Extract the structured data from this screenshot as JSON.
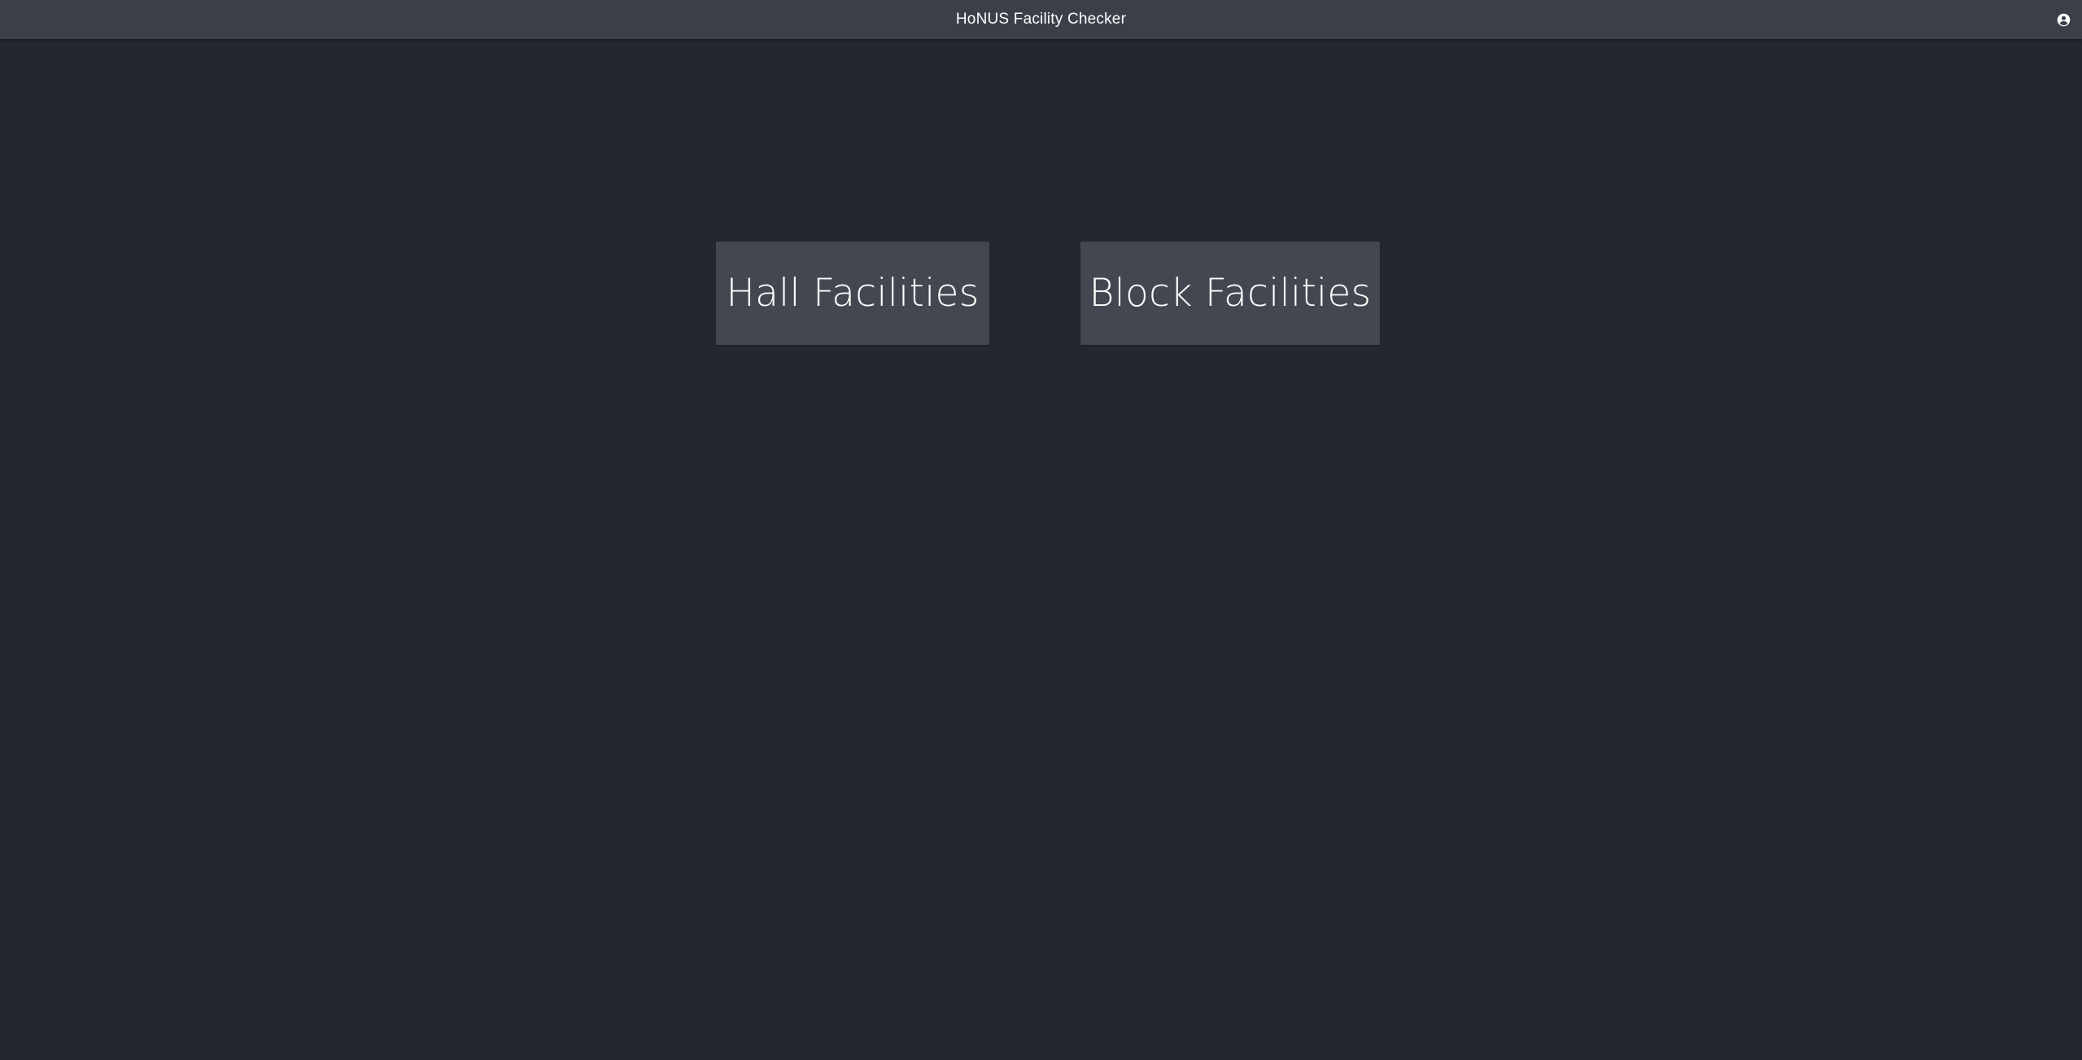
{
  "header": {
    "title": "HoNUS Facility Checker",
    "account_icon": "account-circle-icon"
  },
  "main": {
    "tiles": [
      {
        "label": "Hall Facilities"
      },
      {
        "label": "Block Facilities"
      }
    ]
  },
  "colors": {
    "background": "#222731",
    "topbar": "#3b3f49",
    "tile": "#434750",
    "text": "#ffffff"
  }
}
